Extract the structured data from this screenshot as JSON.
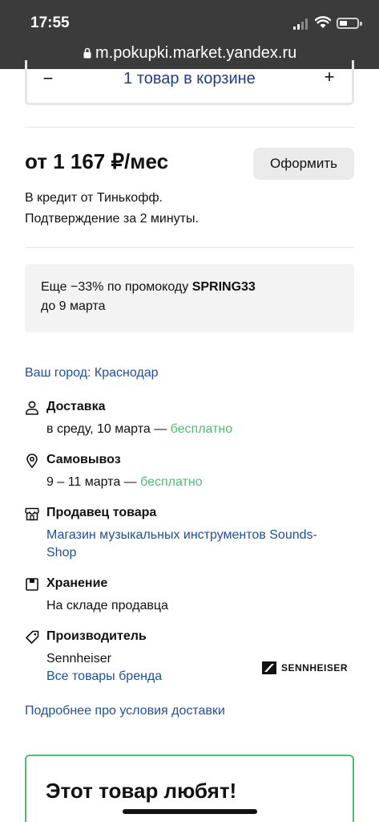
{
  "status_bar": {
    "time": "17:55"
  },
  "browser": {
    "url": "m.pokupki.market.yandex.ru"
  },
  "cart": {
    "minus": "−",
    "label": "1 товар в корзине",
    "plus": "+"
  },
  "price": {
    "amount": "от 1 167 ₽/мес",
    "checkout_label": "Оформить",
    "credit_line1": "В кредит от Тинькофф.",
    "credit_line2": "Подтверждение за 2 минуты."
  },
  "promo": {
    "text_before": "Еще −33% по промокоду ",
    "code": "SPRING33",
    "until": "до 9 марта"
  },
  "city": "Ваш город: Краснодар",
  "delivery": {
    "title": "Доставка",
    "date": "в среду, 10 марта — ",
    "price": "бесплатно",
    "icon": "person-icon"
  },
  "pickup": {
    "title": "Самовывоз",
    "date": "9 – 11 марта — ",
    "price": "бесплатно",
    "icon": "location-pin-icon"
  },
  "seller": {
    "title": "Продавец товара",
    "name_line1": "Магазин музыкальных инструментов Sounds-",
    "name_line2": "Shop",
    "icon": "store-icon"
  },
  "storage": {
    "title": "Хранение",
    "text": "На складе продавца",
    "icon": "box-icon"
  },
  "manufacturer": {
    "title": "Производитель",
    "name": "Sennheiser",
    "all_products": "Все товары бренда",
    "logo_text": "SENNHEISER",
    "icon": "tag-icon"
  },
  "more_link": "Подробнее про условия доставки",
  "popular": {
    "heading": "Этот товар любят!"
  },
  "colors": {
    "link": "#1f4fa3",
    "free": "#4fbf72",
    "accent_border": "#4fbf72"
  }
}
